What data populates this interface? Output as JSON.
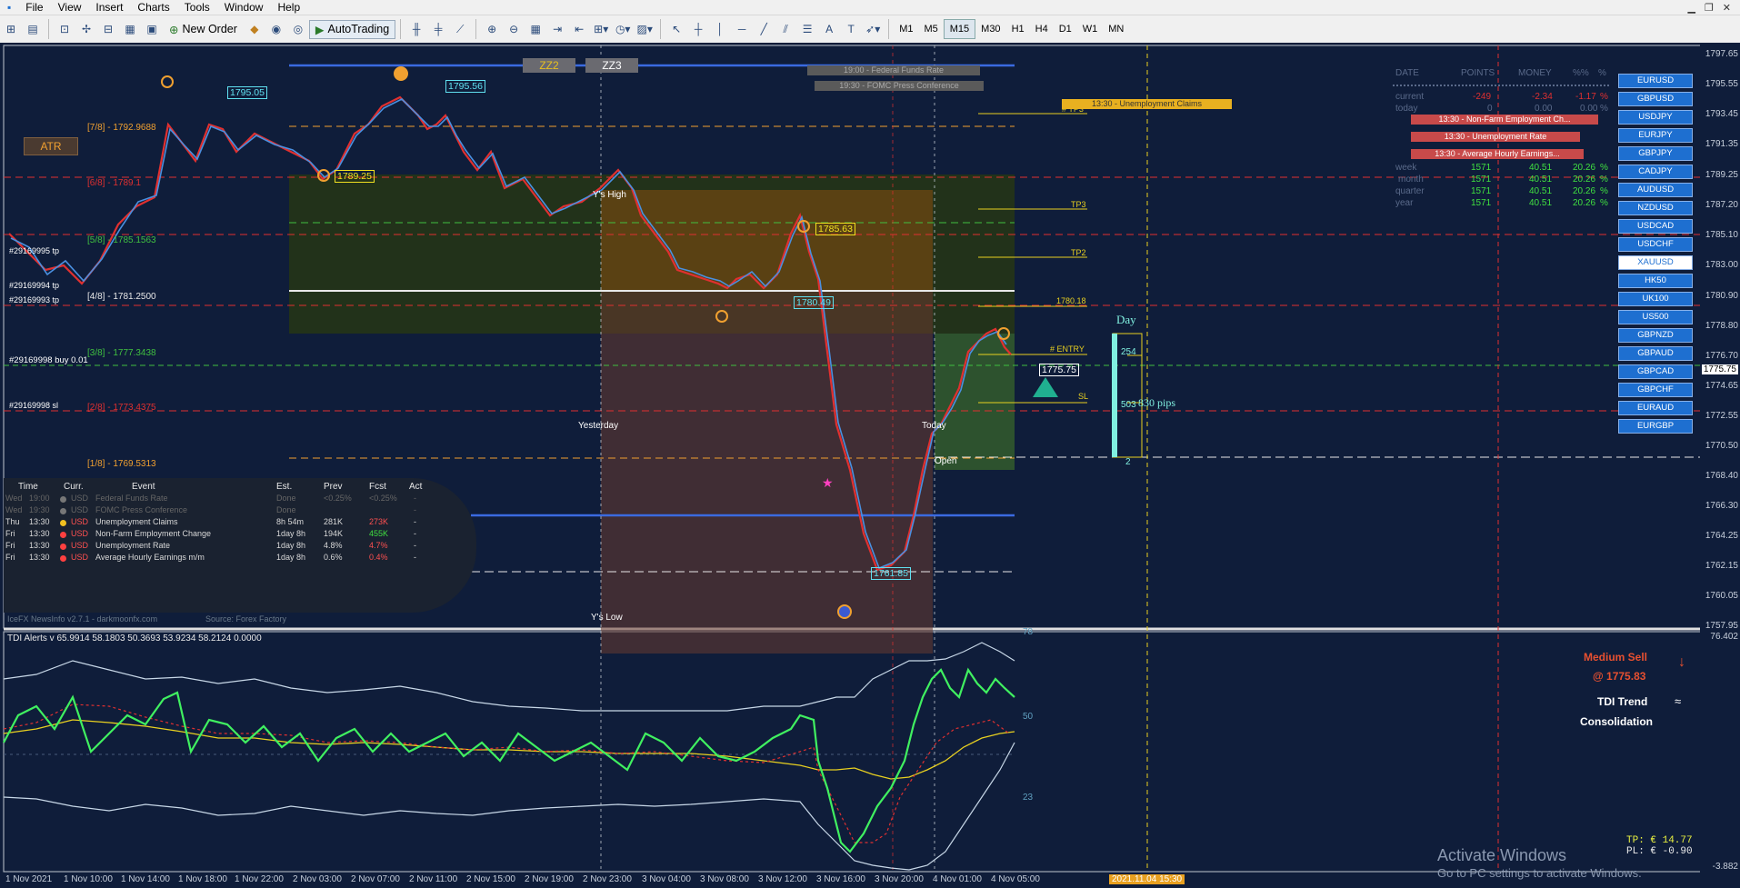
{
  "menu": [
    "File",
    "View",
    "Insert",
    "Charts",
    "Tools",
    "Window",
    "Help"
  ],
  "toolbar": {
    "new_order": "New Order",
    "autotrading": "AutoTrading"
  },
  "timeframes": [
    "M1",
    "M5",
    "M15",
    "M30",
    "H1",
    "H4",
    "D1",
    "W1",
    "MN"
  ],
  "active_timeframe": "M15",
  "zz_buttons": [
    "ZZ2",
    "ZZ3"
  ],
  "atr_button": "ATR",
  "price_axis": [
    "1797.65",
    "1795.55",
    "1793.45",
    "1791.35",
    "1789.25",
    "1787.20",
    "1785.10",
    "1783.00",
    "1780.90",
    "1778.80",
    "1776.70",
    "1774.65",
    "1772.55",
    "1770.50",
    "1768.40",
    "1766.30",
    "1764.25",
    "1762.15",
    "1760.05",
    "1757.95"
  ],
  "current_price_tag": "1775.75",
  "time_axis": [
    "1 Nov 2021",
    "1 Nov 10:00",
    "1 Nov 14:00",
    "1 Nov 18:00",
    "1 Nov 22:00",
    "2 Nov 03:00",
    "2 Nov 07:00",
    "2 Nov 11:00",
    "2 Nov 15:00",
    "2 Nov 19:00",
    "2 Nov 23:00",
    "3 Nov 04:00",
    "3 Nov 08:00",
    "3 Nov 12:00",
    "3 Nov 16:00",
    "3 Nov 20:00",
    "4 Nov 01:00",
    "4 Nov 05:00"
  ],
  "time_highlight": "2021.11.04 15:30",
  "murrey": [
    {
      "label": "[7/8] - 1792.9688",
      "color": "#f0a030"
    },
    {
      "label": "[6/8] - 1789.1",
      "color": "#e03030"
    },
    {
      "label": "[5/8] - 1785.1563",
      "color": "#40c040"
    },
    {
      "label": "[4/8] - 1781.2500",
      "color": "#e8e8e8"
    },
    {
      "label": "[3/8] - 1777.3438",
      "color": "#40c040"
    },
    {
      "label": "[2/8] - 1773.4375",
      "color": "#e03030"
    },
    {
      "label": "[1/8] - 1769.5313",
      "color": "#f0a030"
    }
  ],
  "orders": [
    "#29169995 tp",
    "#29169994 tp",
    "#29169993 tp",
    "#29169998 buy 0.01",
    "#29169998 sl"
  ],
  "price_tags": [
    "1795.05",
    "1795.56",
    "1789.25",
    "1785.63",
    "1780.49",
    "1761.85",
    "1775.75"
  ],
  "chart_labels": {
    "yhigh": "Y's High",
    "ylow": "Y's Low",
    "yesterday": "Yesterday",
    "today": "Today",
    "open": "Open",
    "tp3": "TP3",
    "tp2": "TP2",
    "tp_top": "# TP3",
    "entry": "# ENTRY",
    "sl": "SL",
    "level": "1780.18"
  },
  "events_top": [
    "19:00 - Federal Funds Rate",
    "19:30 - FOMC Press Conference",
    "13:30 - Unemployment Claims"
  ],
  "day_gauge": {
    "title": "Day",
    "v1": "254",
    "v2": "503",
    "pips": "830 pips",
    "v3": "2"
  },
  "news": {
    "headers": [
      "Time",
      "Curr.",
      "Event",
      "Est.",
      "Prev",
      "Fcst",
      "Act"
    ],
    "rows": [
      {
        "day": "Wed",
        "time": "19:00",
        "curr": "USD",
        "event": "Federal Funds Rate",
        "est": "Done",
        "prev": "<0.25%",
        "fcst": "<0.25%",
        "act": "-",
        "dot": "#777",
        "dim": true
      },
      {
        "day": "Wed",
        "time": "19:30",
        "curr": "USD",
        "event": "FOMC Press Conference",
        "est": "Done",
        "prev": "",
        "fcst": "",
        "act": "-",
        "dot": "#777",
        "dim": true
      },
      {
        "day": "Thu",
        "time": "13:30",
        "curr": "USD",
        "event": "Unemployment Claims",
        "est": "8h 54m",
        "prev": "281K",
        "fcst": "273K",
        "act": "-",
        "dot": "#f0c020",
        "dim": false,
        "fc": "#ff5050"
      },
      {
        "day": "Fri",
        "time": "13:30",
        "curr": "USD",
        "event": "Non-Farm Employment Change",
        "est": "1day 8h",
        "prev": "194K",
        "fcst": "455K",
        "act": "-",
        "dot": "#ff4040",
        "dim": false,
        "fc": "#40e040"
      },
      {
        "day": "Fri",
        "time": "13:30",
        "curr": "USD",
        "event": "Unemployment Rate",
        "est": "1day 8h",
        "prev": "4.8%",
        "fcst": "4.7%",
        "act": "-",
        "dot": "#ff4040",
        "dim": false,
        "fc": "#ff5050"
      },
      {
        "day": "Fri",
        "time": "13:30",
        "curr": "USD",
        "event": "Average Hourly Earnings m/m",
        "est": "1day 8h",
        "prev": "0.6%",
        "fcst": "0.4%",
        "act": "-",
        "dot": "#ff4040",
        "dim": false,
        "fc": "#ff5050"
      }
    ],
    "footer_left": "IceFX NewsInfo v2.7.1  -  darkmoonfx.com",
    "footer_right": "Source: Forex Factory"
  },
  "account": {
    "headers": [
      "DATE",
      "POINTS",
      "MONEY",
      "%%",
      "%"
    ],
    "rows": [
      {
        "label": "current",
        "points": "-249",
        "money": "-2.34",
        "pct": "-1.17",
        "pct2": "%"
      },
      {
        "label": "today",
        "points": "0",
        "money": "0.00",
        "pct": "0.00",
        "pct2": "%"
      },
      {
        "label": "week",
        "points": "1571",
        "money": "40.51",
        "pct": "20.26",
        "pct2": "%"
      },
      {
        "label": "month",
        "points": "1571",
        "money": "40.51",
        "pct": "20.26",
        "pct2": "%"
      },
      {
        "label": "quarter",
        "points": "1571",
        "money": "40.51",
        "pct": "20.26",
        "pct2": "%"
      },
      {
        "label": "year",
        "points": "1571",
        "money": "40.51",
        "pct": "20.26",
        "pct2": "%"
      }
    ],
    "overlay_events": [
      "13:30 - Non-Farm Employment Ch...",
      "13:30 - Unemployment Rate",
      "13:30 - Average Hourly Earnings..."
    ]
  },
  "symbols": [
    "EURUSD",
    "GBPUSD",
    "USDJPY",
    "EURJPY",
    "GBPJPY",
    "CADJPY",
    "AUDUSD",
    "NZDUSD",
    "USDCAD",
    "USDCHF",
    "XAUUSD",
    "HK50",
    "UK100",
    "US500",
    "GBPNZD",
    "GBPAUD",
    "GBPCAD",
    "GBPCHF",
    "EURAUD",
    "EURGBP"
  ],
  "active_symbol": "XAUUSD",
  "tdi": {
    "header": "TDI Alerts v 65.9914 58.1803 50.3693 53.9234 58.2124 0.0000",
    "levels": [
      "78",
      "50",
      "23"
    ],
    "scale_top": "76.402",
    "scale_bottom": "-3.882",
    "signal": "Medium Sell",
    "signal_price": "@ 1775.83",
    "trend_label": "TDI Trend",
    "trend_value": "Consolidation"
  },
  "tp_line": "TP: € 14.77",
  "pl_line": "PL: € -0.90",
  "watermark1": "Activate Windows",
  "watermark2": "Go to PC settings to activate Windows."
}
